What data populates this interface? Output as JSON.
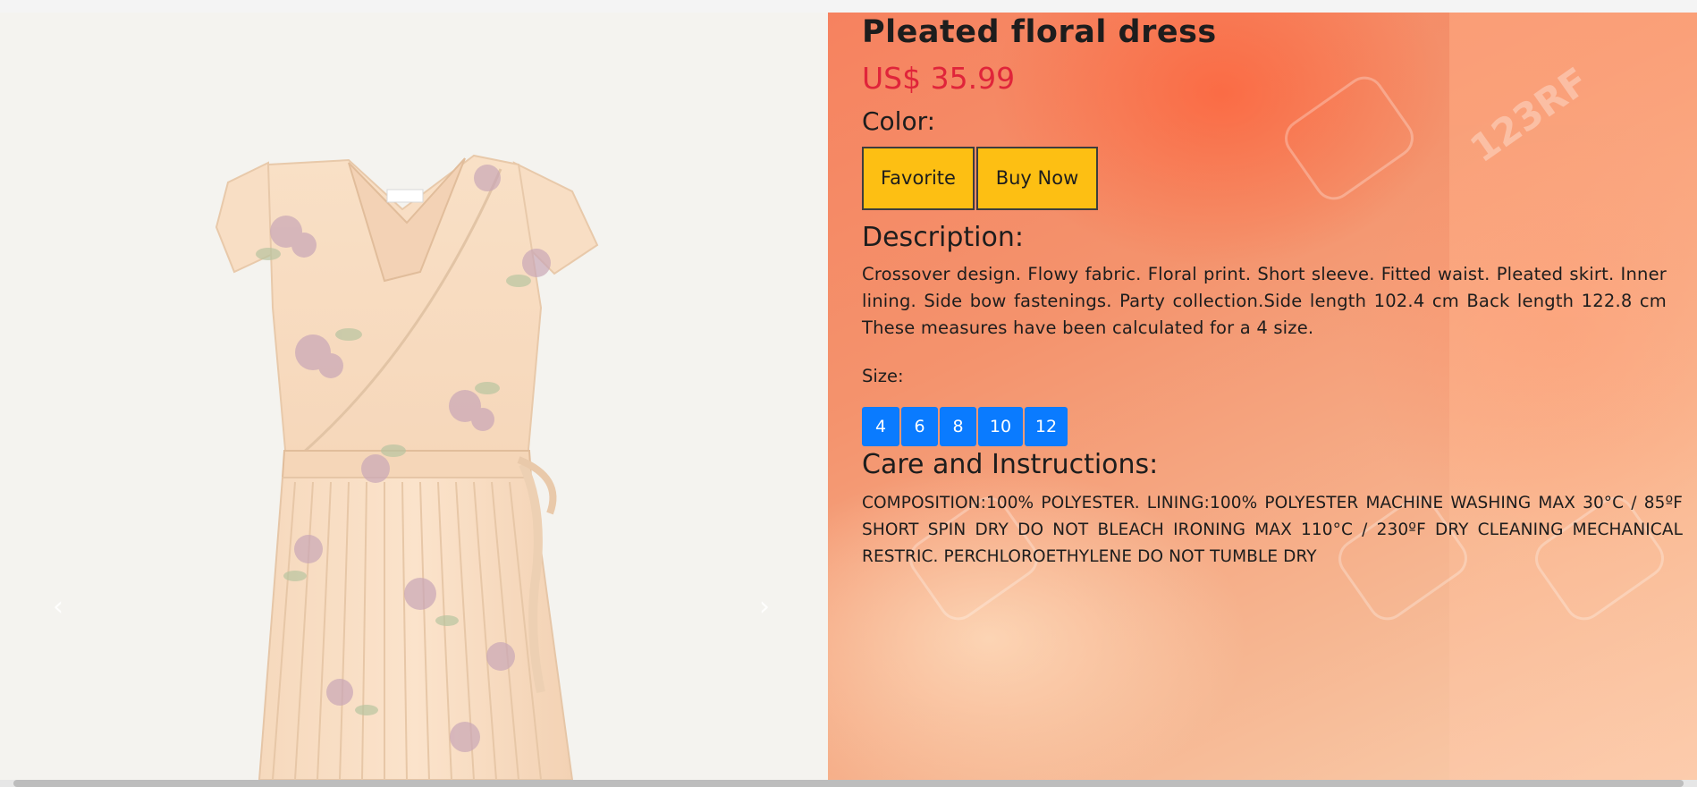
{
  "product": {
    "title": "Pleated floral dress",
    "price": "US$ 35.99",
    "color_label": "Color:",
    "buttons": {
      "favorite": "Favorite",
      "buy_now": "Buy Now"
    },
    "description_label": "Description:",
    "description": "Crossover design. Flowy fabric. Floral print. Short sleeve. Fitted waist. Pleated skirt. Inner lining. Side bow fastenings. Party collection.Side length 102.4 cm Back length 122.8 cm These measures have been calculated for a 4 size.",
    "size_label": "Size:",
    "sizes": [
      "4",
      "6",
      "8",
      "10",
      "12"
    ],
    "care_label": "Care and Instructions:",
    "care": "COMPOSITION:100% POLYESTER. LINING:100% POLYESTER MACHINE WASHING MAX 30°C / 85ºF SHORT SPIN DRY DO NOT BLEACH IRONING MAX 110°C / 230ºF DRY CLEANING MECHANICAL RESTRIC. PERCHLOROETHYLENE DO NOT TUMBLE DRY"
  },
  "carousel": {
    "prev_icon": "chevron-left-icon",
    "next_icon": "chevron-right-icon",
    "prev_glyph": "‹",
    "next_glyph": "›"
  },
  "colors": {
    "price": "#e0243a",
    "button_bg": "#fdbf13",
    "size_bg": "#0a7bff"
  }
}
